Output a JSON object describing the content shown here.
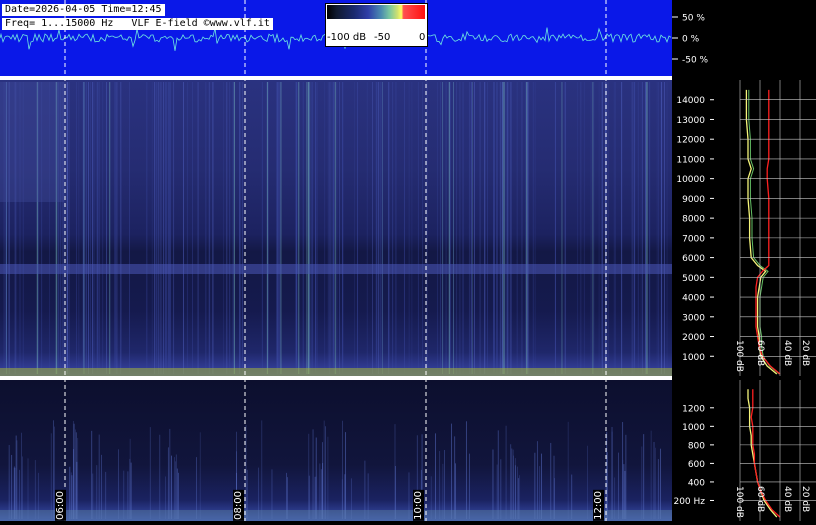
{
  "header": {
    "line1": "Date=2026-04-05 Time=12:45",
    "line2": "Freq= 1...15000 Hz   VLF E-field ©www.vlf.it"
  },
  "color_scale": {
    "labels": [
      "-100 dB",
      "-50",
      "0"
    ]
  },
  "colors": {
    "waveform_bg": "#0a18e8",
    "spectrogram_bg": "#0c0f2e",
    "line_yellow": "#f5f57a",
    "line_green": "#7ef07e",
    "line_red": "#ff2020",
    "grid": "#ffffff"
  },
  "chart_data": [
    {
      "type": "line",
      "panel": "waveform",
      "yticks": [
        "50 %",
        "0 %",
        "-50 %"
      ],
      "ylim": [
        -70,
        70
      ]
    },
    {
      "type": "heatmap",
      "panel": "spectrogram-main",
      "y_unit": "Hz",
      "ylim": [
        0,
        15000
      ],
      "yticks": [
        1000,
        2000,
        3000,
        4000,
        5000,
        6000,
        7000,
        8000,
        9000,
        10000,
        11000,
        12000,
        13000,
        14000
      ],
      "xticks_time": [
        "06:00",
        "08:00",
        "10:00",
        "12:00"
      ],
      "grid": true
    },
    {
      "type": "line",
      "panel": "spectrum-main",
      "xlabels": [
        "100 dB",
        "60 dB",
        "40 dB",
        "20 dB"
      ],
      "freq": [
        100,
        500,
        1000,
        1500,
        2000,
        2500,
        3000,
        3500,
        4000,
        4500,
        5000,
        5300,
        5600,
        6000,
        7000,
        8000,
        9000,
        10000,
        10500,
        11000,
        12000,
        13000,
        14000,
        14500
      ],
      "series": [
        {
          "color": "yellow",
          "values": [
            -22,
            -28,
            -32,
            -33,
            -33,
            -34,
            -34,
            -34,
            -34,
            -33,
            -32,
            -29,
            -34,
            -38,
            -39,
            -39,
            -40,
            -40,
            -38,
            -40,
            -40,
            -41,
            -41,
            -41
          ]
        },
        {
          "color": "red",
          "values": [
            -20,
            -26,
            -31,
            -33,
            -34,
            -35,
            -35,
            -35,
            -35,
            -35,
            -34,
            -31,
            -27,
            -27,
            -27,
            -27,
            -27,
            -28,
            -28,
            -27,
            -27,
            -27,
            -27,
            -27
          ]
        }
      ]
    },
    {
      "type": "heatmap",
      "panel": "spectrogram-low",
      "y_unit": "Hz",
      "ylim": [
        0,
        1500
      ],
      "yticks": [
        "200 Hz",
        "400",
        "600",
        "800",
        "1000",
        "1200"
      ],
      "grid": true
    },
    {
      "type": "line",
      "panel": "spectrum-low",
      "xlabels": [
        "100 dB",
        "60 dB",
        "40 dB",
        "20 dB"
      ],
      "freq": [
        20,
        100,
        200,
        300,
        400,
        500,
        600,
        700,
        800,
        900,
        1000,
        1100,
        1200,
        1300,
        1400
      ],
      "series": [
        {
          "color": "yellow",
          "values": [
            -22,
            -26,
            -30,
            -32,
            -34,
            -35,
            -36,
            -37,
            -38,
            -38,
            -39,
            -39,
            -39,
            -40,
            -40
          ]
        },
        {
          "color": "red",
          "values": [
            -20,
            -25,
            -29,
            -32,
            -34,
            -35,
            -36,
            -36,
            -37,
            -37,
            -37,
            -38,
            -37,
            -37,
            -37
          ]
        }
      ]
    }
  ]
}
